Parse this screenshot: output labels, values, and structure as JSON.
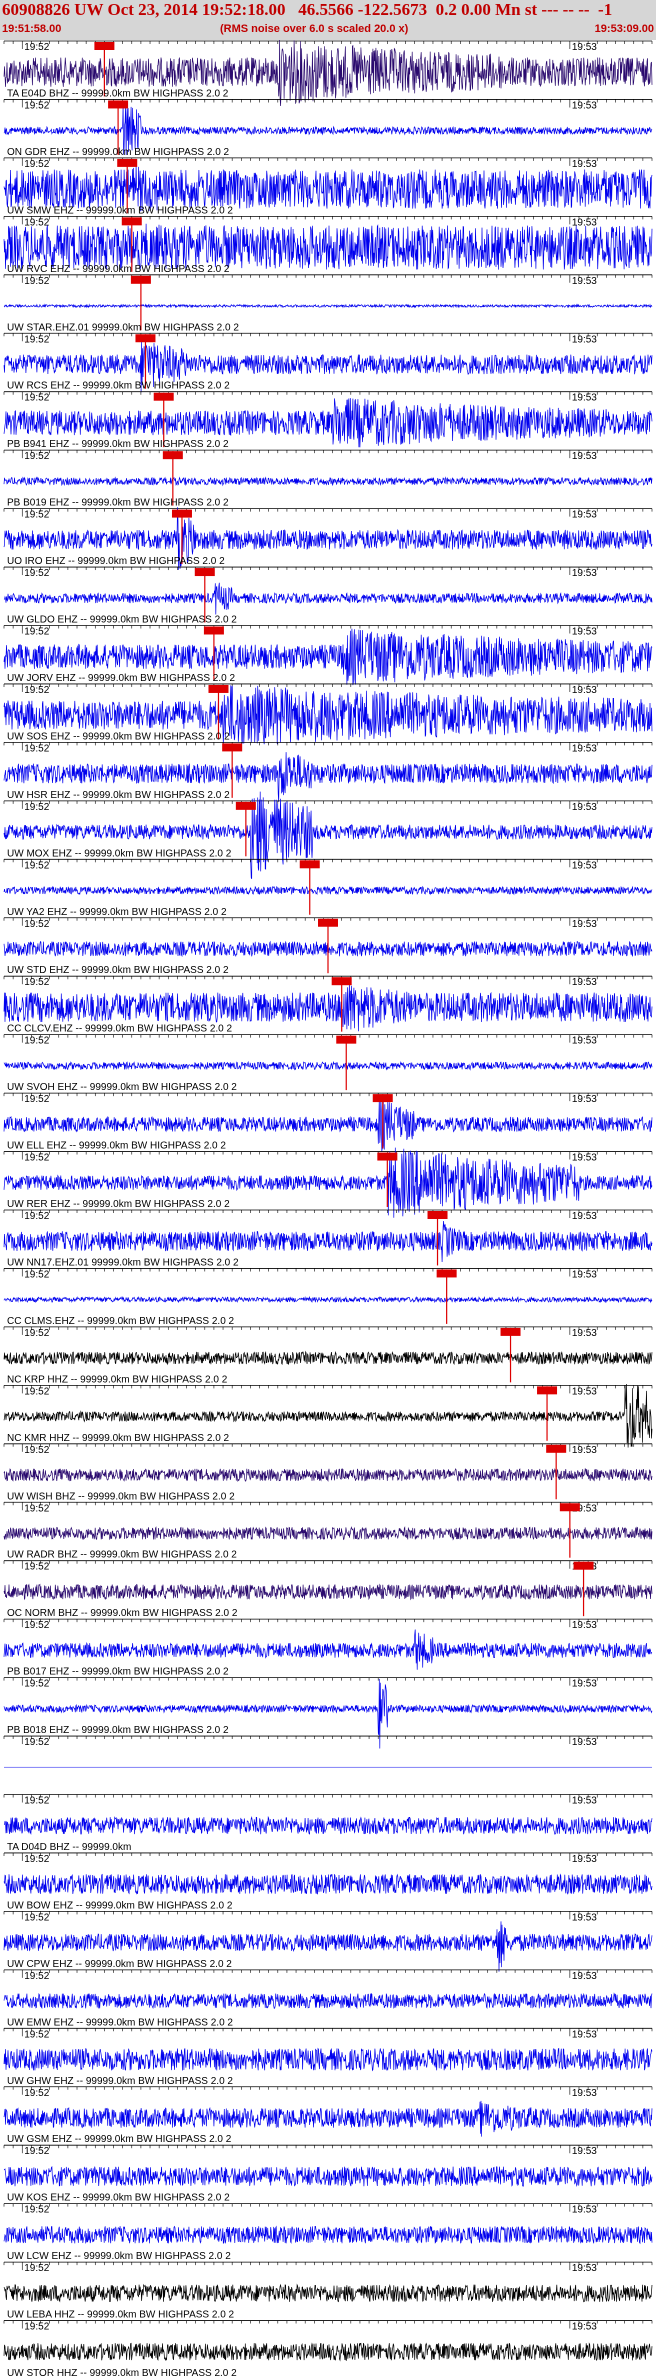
{
  "header": {
    "title": "60908826 UW Oct 23, 2014 19:52:18.00   46.5566 -122.5673  0.2 0.00 Mn st --- -- --  -1",
    "start_time": "19:51:58.00",
    "subtitle": "(RMS noise over 6.0 s scaled 20.0 x)",
    "end_time": "19:53:09.00"
  },
  "colors": {
    "header_bg": "#d6d6d6",
    "header_text": "#c00000",
    "trace_blue": "#0000ee",
    "trace_black": "#000000",
    "trace_purple": "#2a0a6e",
    "pick_red": "#dd0000",
    "grid": "#000000"
  },
  "chart_data": {
    "type": "line",
    "time_range": [
      "19:51:58.00",
      "19:53:09.00"
    ],
    "minute_tick_labels": [
      "19:52",
      "19:53"
    ],
    "traces": [
      {
        "label": "TA E04D BHZ -- 99999.0km BW  HIGHPASS  2.0  2",
        "pick_s": 11.0,
        "color": "purple",
        "amplitude": 0.6,
        "burst_s": [
          30,
          55
        ],
        "burst_amp": 1.4
      },
      {
        "label": "ON GDR EHZ -- 99999.0km BW  HIGHPASS  2.0  2",
        "pick_s": 12.5,
        "color": "blue",
        "amplitude": 0.15,
        "burst_s": [
          13,
          15
        ],
        "burst_amp": 1.5
      },
      {
        "label": "UW SMW EHZ -- 99999.0km BW  HIGHPASS  2.0  2",
        "pick_s": 13.5,
        "color": "blue",
        "amplitude": 0.8,
        "burst_s": [
          14,
          30
        ],
        "burst_amp": 1.0
      },
      {
        "label": "UW RVC EHZ -- 99999.0km BW  HIGHPASS  2.0  2",
        "pick_s": 14.0,
        "color": "blue",
        "amplitude": 0.9,
        "burst_s": [
          15,
          40
        ],
        "burst_amp": 1.0
      },
      {
        "label": "UW STAR.EHZ.01 99999.0km BW  HIGHPASS  2.0  2",
        "pick_s": 15.0,
        "color": "blue",
        "amplitude": 0.05,
        "burst_s": [
          0,
          0
        ],
        "burst_amp": 0.0
      },
      {
        "label": "UW RCS EHZ -- 99999.0km BW  HIGHPASS  2.0  2",
        "pick_s": 15.5,
        "color": "blue",
        "amplitude": 0.4,
        "burst_s": [
          15,
          20
        ],
        "burst_amp": 1.2
      },
      {
        "label": "PB B941 EHZ -- 99999.0km BW  HIGHPASS  2.0  2",
        "pick_s": 17.5,
        "color": "blue",
        "amplitude": 0.5,
        "burst_s": [
          36,
          66
        ],
        "burst_amp": 1.1
      },
      {
        "label": "PB B019 EHZ -- 99999.0km BW  HIGHPASS  2.0  2",
        "pick_s": 18.5,
        "color": "blue",
        "amplitude": 0.15,
        "burst_s": [
          0,
          0
        ],
        "burst_amp": 0.0
      },
      {
        "label": "UO IRO EHZ -- 99999.0km BW  HIGHPASS  2.0  2",
        "pick_s": 19.5,
        "color": "blue",
        "amplitude": 0.4,
        "burst_s": [
          19,
          21
        ],
        "burst_amp": 1.4
      },
      {
        "label": "UW GLDO EHZ -- 99999.0km BW  HIGHPASS  2.0  2",
        "pick_s": 22.0,
        "color": "blue",
        "amplitude": 0.2,
        "burst_s": [
          23,
          25
        ],
        "burst_amp": 0.8
      },
      {
        "label": "UW JORV EHZ -- 99999.0km BW  HIGHPASS  2.0  2",
        "pick_s": 23.0,
        "color": "blue",
        "amplitude": 0.5,
        "burst_s": [
          37,
          71
        ],
        "burst_amp": 1.2
      },
      {
        "label": "UW SOS EHZ -- 99999.0km BW  HIGHPASS  2.0  2",
        "pick_s": 23.5,
        "color": "blue",
        "amplitude": 0.6,
        "burst_s": [
          24,
          71
        ],
        "burst_amp": 1.3
      },
      {
        "label": "UW HSR EHZ -- 99999.0km BW  HIGHPASS  2.0  2",
        "pick_s": 25.0,
        "color": "blue",
        "amplitude": 0.4,
        "burst_s": [
          30,
          34
        ],
        "burst_amp": 1.2
      },
      {
        "label": "UW MOX EHZ -- 99999.0km BW  HIGHPASS  2.0  2",
        "pick_s": 26.5,
        "color": "blue",
        "amplitude": 0.3,
        "burst_s": [
          27,
          34
        ],
        "burst_amp": 2.0
      },
      {
        "label": "UW YA2 EHZ -- 99999.0km BW  HIGHPASS  2.0  2",
        "pick_s": 33.5,
        "color": "blue",
        "amplitude": 0.15,
        "burst_s": [
          0,
          0
        ],
        "burst_amp": 0.0
      },
      {
        "label": "UW STD EHZ -- 99999.0km BW  HIGHPASS  2.0  2",
        "pick_s": 35.5,
        "color": "blue",
        "amplitude": 0.3,
        "burst_s": [
          0,
          0
        ],
        "burst_amp": 0.0
      },
      {
        "label": "CC CLCV.EHZ -- 99999.0km BW  HIGHPASS  2.0  2",
        "pick_s": 37.0,
        "color": "blue",
        "amplitude": 0.6,
        "burst_s": [
          37,
          45
        ],
        "burst_amp": 1.2
      },
      {
        "label": "UW SVOH EHZ -- 99999.0km BW  HIGHPASS  2.0  2",
        "pick_s": 37.5,
        "color": "blue",
        "amplitude": 0.15,
        "burst_s": [
          0,
          0
        ],
        "burst_amp": 0.0
      },
      {
        "label": "UW ELL EHZ -- 99999.0km BW  HIGHPASS  2.0  2",
        "pick_s": 41.5,
        "color": "blue",
        "amplitude": 0.3,
        "burst_s": [
          41,
          45
        ],
        "burst_amp": 1.2
      },
      {
        "label": "UW RER EHZ -- 99999.0km BW  HIGHPASS  2.0  2",
        "pick_s": 42.0,
        "color": "blue",
        "amplitude": 0.3,
        "burst_s": [
          42,
          63
        ],
        "burst_amp": 1.5
      },
      {
        "label": "UW NN17.EHZ.01 99999.0km BW  HIGHPASS  2.0  2",
        "pick_s": 47.5,
        "color": "blue",
        "amplitude": 0.4,
        "burst_s": [
          48,
          50
        ],
        "burst_amp": 0.9
      },
      {
        "label": "CC CLMS.EHZ -- 99999.0km BW  HIGHPASS  2.0  2",
        "pick_s": 48.5,
        "color": "blue",
        "amplitude": 0.1,
        "burst_s": [
          0,
          0
        ],
        "burst_amp": 0.0
      },
      {
        "label": "NC KRP HHZ -- 99999.0km BW  HIGHPASS  2.0  2",
        "pick_s": 55.5,
        "color": "black",
        "amplitude": 0.25,
        "burst_s": [
          0,
          0
        ],
        "burst_amp": 0.0
      },
      {
        "label": "NC KMR HHZ -- 99999.0km BW  HIGHPASS  2.0  2",
        "pick_s": 59.5,
        "color": "black",
        "amplitude": 0.2,
        "burst_s": [
          68,
          71
        ],
        "burst_amp": 1.8
      },
      {
        "label": "UW WISH BHZ -- 99999.0km BW  HIGHPASS  2.0  2",
        "pick_s": 60.5,
        "color": "purple",
        "amplitude": 0.25,
        "burst_s": [
          0,
          0
        ],
        "burst_amp": 0.0
      },
      {
        "label": "UW RADR BHZ -- 99999.0km BW  HIGHPASS  2.0  2",
        "pick_s": 62.0,
        "color": "purple",
        "amplitude": 0.25,
        "burst_s": [
          0,
          0
        ],
        "burst_amp": 0.0
      },
      {
        "label": "OC NORM BHZ -- 99999.0km BW  HIGHPASS  2.0  2",
        "pick_s": 63.5,
        "color": "purple",
        "amplitude": 0.3,
        "burst_s": [
          0,
          0
        ],
        "burst_amp": 0.0
      },
      {
        "label": "PB B017 EHZ -- 99999.0km BW  HIGHPASS  2.0  2",
        "pick_s": null,
        "color": "blue",
        "amplitude": 0.3,
        "burst_s": [
          45,
          47
        ],
        "burst_amp": 1.0
      },
      {
        "label": "PB B018 EHZ -- 99999.0km BW  HIGHPASS  2.0  2",
        "pick_s": null,
        "color": "blue",
        "amplitude": 0.15,
        "burst_s": [
          41,
          42
        ],
        "burst_amp": 2.0
      },
      {
        "label": "",
        "pick_s": null,
        "color": "blue",
        "amplitude": 0.0,
        "burst_s": [
          0,
          0
        ],
        "burst_amp": 0.0
      },
      {
        "label": "TA D04D BHZ -- 99999.0km",
        "pick_s": null,
        "color": "blue",
        "amplitude": 0.35,
        "burst_s": [
          0,
          0
        ],
        "burst_amp": 0.0
      },
      {
        "label": "UW BOW EHZ -- 99999.0km BW  HIGHPASS  2.0  2",
        "pick_s": null,
        "color": "blue",
        "amplitude": 0.4,
        "burst_s": [
          0,
          0
        ],
        "burst_amp": 0.0
      },
      {
        "label": "UW CPW EHZ -- 99999.0km BW  HIGHPASS  2.0  2",
        "pick_s": null,
        "color": "blue",
        "amplitude": 0.35,
        "burst_s": [
          54,
          55
        ],
        "burst_amp": 1.5
      },
      {
        "label": "UW EMW EHZ -- 99999.0km BW  HIGHPASS  2.0  2",
        "pick_s": null,
        "color": "blue",
        "amplitude": 0.3,
        "burst_s": [
          0,
          0
        ],
        "burst_amp": 0.0
      },
      {
        "label": "UW GHW EHZ -- 99999.0km BW  HIGHPASS  2.0  2",
        "pick_s": null,
        "color": "blue",
        "amplitude": 0.45,
        "burst_s": [
          0,
          0
        ],
        "burst_amp": 0.0
      },
      {
        "label": "UW GSM EHZ -- 99999.0km BW  HIGHPASS  2.0  2",
        "pick_s": null,
        "color": "blue",
        "amplitude": 0.4,
        "burst_s": [
          52,
          58
        ],
        "burst_amp": 0.8
      },
      {
        "label": "UW KOS EHZ -- 99999.0km BW  HIGHPASS  2.0  2",
        "pick_s": null,
        "color": "blue",
        "amplitude": 0.4,
        "burst_s": [
          0,
          0
        ],
        "burst_amp": 0.0
      },
      {
        "label": "UW LCW EHZ -- 99999.0km BW  HIGHPASS  2.0  2",
        "pick_s": null,
        "color": "blue",
        "amplitude": 0.35,
        "burst_s": [
          0,
          0
        ],
        "burst_amp": 0.0
      },
      {
        "label": "UW LEBA HHZ -- 99999.0km BW  HIGHPASS  2.0  2",
        "pick_s": null,
        "color": "black",
        "amplitude": 0.35,
        "burst_s": [
          0,
          0
        ],
        "burst_amp": 0.0
      },
      {
        "label": "UW STOR HHZ -- 99999.0km BW  HIGHPASS  2.0  2",
        "pick_s": null,
        "color": "black",
        "amplitude": 0.35,
        "burst_s": [
          0,
          0
        ],
        "burst_amp": 0.0
      }
    ]
  }
}
